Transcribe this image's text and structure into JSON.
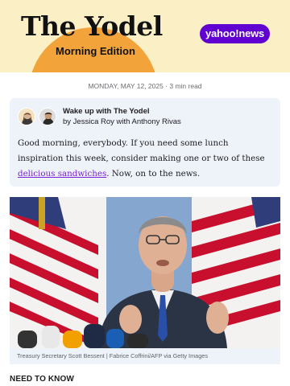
{
  "masthead": {
    "title": "The Yodel",
    "edition": "Morning Edition",
    "badge": "yahoo!news"
  },
  "article": {
    "dateline": "MONDAY, MAY 12, 2025 · 3 min read",
    "intro": {
      "title": "Wake up with The Yodel",
      "authors": "by Jessica Roy with Anthony Rivas",
      "text_before": "Good morning, everybody. If you need some lunch inspiration this week, consider making one or two of these ",
      "link_text": "delicious sandwiches",
      "text_after": ". Now, on to the news."
    },
    "photo": {
      "caption": "Treasury Secretary Scott Bessent | Fabrice Coffrini/AFP via Getty Images"
    },
    "section_heading": "NEED TO KNOW"
  },
  "colors": {
    "masthead_bg": "#fbf0c5",
    "sun": "#f2a33a",
    "badge_bg": "#6001d2",
    "card_bg": "#eef2f9",
    "link": "#7b1fd4"
  }
}
